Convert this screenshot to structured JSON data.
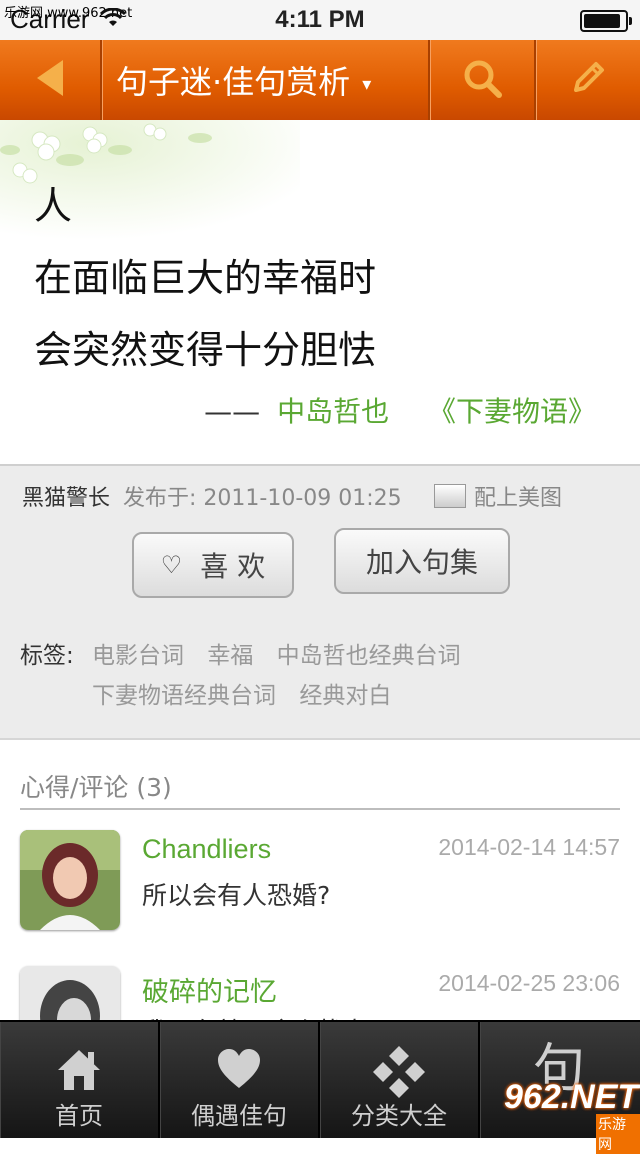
{
  "status_bar": {
    "carrier": "Carrier",
    "watermark": "乐游网 www.962.net",
    "time": "4:11 PM",
    "battery_level": 0.95
  },
  "navbar": {
    "back_icon": "back-arrow-icon",
    "title": "句子迷·佳句赏析",
    "title_caret": "▾",
    "search_icon": "search-icon",
    "edit_icon": "pencil-icon",
    "accent_color": "#e05c00"
  },
  "quote": {
    "lines": [
      "人",
      "在面临巨大的幸福时",
      "会突然变得十分胆怯"
    ],
    "dash": "——",
    "author": "中岛哲也",
    "work": "《下妻物语》"
  },
  "post_info": {
    "author": "黑猫警长",
    "published_label": "发布于: 2011-10-09 01:25",
    "pic_link": "配上美图",
    "like_button": "喜 欢",
    "like_icon": "♡",
    "add_button": "加入句集",
    "tags_label": "标签:",
    "tags": [
      "电影台词",
      "幸福",
      "中岛哲也经典台词",
      "下妻物语经典台词",
      "经典对白"
    ]
  },
  "comments": {
    "header": "心得/评论 (3)",
    "items": [
      {
        "name": "Chandliers",
        "date": "2014-02-14 14:57",
        "text": "所以会有人恐婚?"
      },
      {
        "name": "破碎的记忆",
        "date": "2014-02-25 23:06",
        "text": "我现在就是这个状态"
      }
    ]
  },
  "tabbar": {
    "tabs": [
      {
        "label": "首页",
        "icon": "home-icon"
      },
      {
        "label": "偶遇佳句",
        "icon": "heart-icon"
      },
      {
        "label": "分类大全",
        "icon": "diamond-grid-icon"
      },
      {
        "label": "句",
        "icon": "ju-character-icon"
      }
    ]
  },
  "logo": {
    "big": "962.NET",
    "small": "乐游网"
  }
}
